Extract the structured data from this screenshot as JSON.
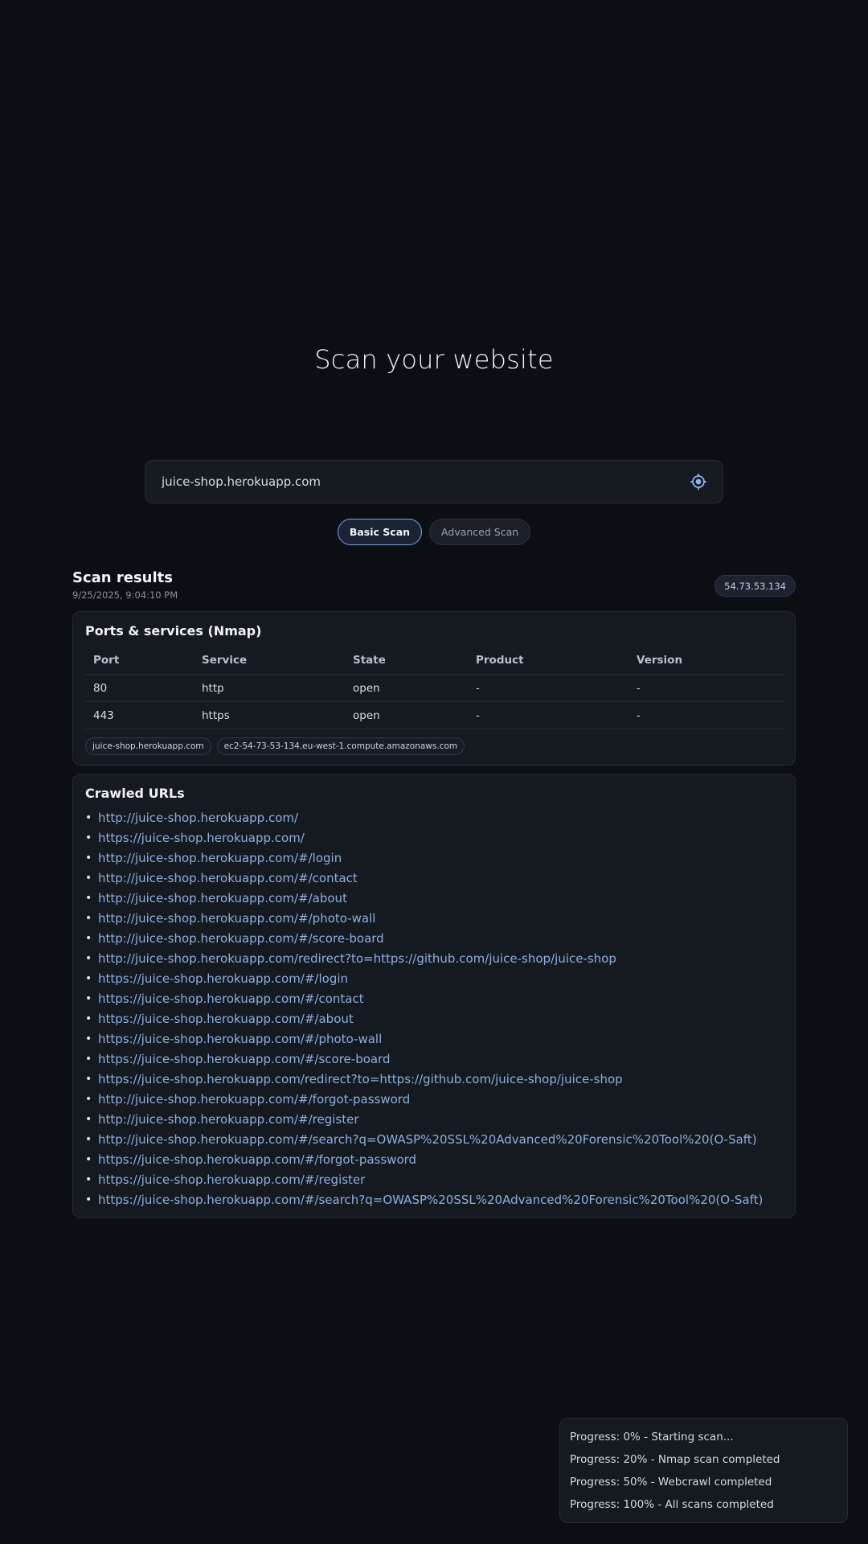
{
  "hero": {
    "title": "Scan your website"
  },
  "search": {
    "value": "juice-shop.herokuapp.com",
    "placeholder": "",
    "icon": "target-icon"
  },
  "scan_types": [
    {
      "label": "Basic Scan",
      "active": true
    },
    {
      "label": "Advanced Scan",
      "active": false
    }
  ],
  "results": {
    "title": "Scan results",
    "timestamp": "9/25/2025, 9:04:10 PM",
    "ip": "54.73.53.134"
  },
  "ports_card": {
    "title": "Ports & services (Nmap)",
    "columns": [
      "Port",
      "Service",
      "State",
      "Product",
      "Version"
    ],
    "rows": [
      [
        "80",
        "http",
        "open",
        "-",
        "-"
      ],
      [
        "443",
        "https",
        "open",
        "-",
        "-"
      ]
    ],
    "hostnames": [
      "juice-shop.herokuapp.com",
      "ec2-54-73-53-134.eu-west-1.compute.amazonaws.com"
    ]
  },
  "urls_card": {
    "title": "Crawled URLs",
    "urls": [
      "http://juice-shop.herokuapp.com/",
      "https://juice-shop.herokuapp.com/",
      "http://juice-shop.herokuapp.com/#/login",
      "http://juice-shop.herokuapp.com/#/contact",
      "http://juice-shop.herokuapp.com/#/about",
      "http://juice-shop.herokuapp.com/#/photo-wall",
      "http://juice-shop.herokuapp.com/#/score-board",
      "http://juice-shop.herokuapp.com/redirect?to=https://github.com/juice-shop/juice-shop",
      "https://juice-shop.herokuapp.com/#/login",
      "https://juice-shop.herokuapp.com/#/contact",
      "https://juice-shop.herokuapp.com/#/about",
      "https://juice-shop.herokuapp.com/#/photo-wall",
      "https://juice-shop.herokuapp.com/#/score-board",
      "https://juice-shop.herokuapp.com/redirect?to=https://github.com/juice-shop/juice-shop",
      "http://juice-shop.herokuapp.com/#/forgot-password",
      "http://juice-shop.herokuapp.com/#/register",
      "http://juice-shop.herokuapp.com/#/search?q=OWASP%20SSL%20Advanced%20Forensic%20Tool%20(O-Saft)",
      "https://juice-shop.herokuapp.com/#/forgot-password",
      "https://juice-shop.herokuapp.com/#/register",
      "https://juice-shop.herokuapp.com/#/search?q=OWASP%20SSL%20Advanced%20Forensic%20Tool%20(O-Saft)"
    ]
  },
  "progress_log": [
    "Progress: 0% - Starting scan...",
    "Progress: 20% - Nmap scan completed",
    "Progress: 50% - Webcrawl completed",
    "Progress: 100% - All scans completed"
  ],
  "colors": {
    "background": "#0b0e13",
    "card": "#151920",
    "accent": "#7fa6e0",
    "link": "#8eafdf"
  }
}
